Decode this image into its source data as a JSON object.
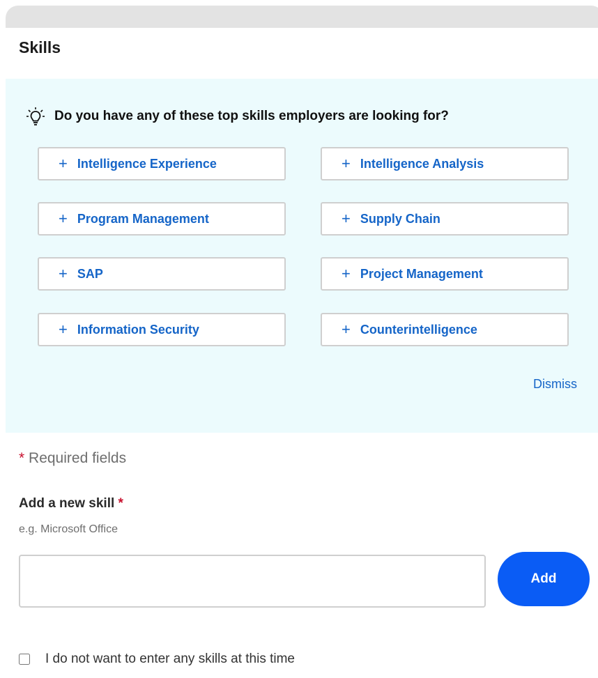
{
  "section": {
    "title": "Skills"
  },
  "suggestions": {
    "heading": "Do you have any of these top skills employers are looking for?",
    "plus_symbol": "+",
    "skills": [
      "Intelligence Experience",
      "Intelligence Analysis",
      "Program Management",
      "Supply Chain",
      "SAP",
      "Project Management",
      "Information Security",
      "Counterintelligence"
    ],
    "dismiss_label": "Dismiss",
    "panel_color": "#ecfbfd",
    "link_color": "#1565c8"
  },
  "form": {
    "required_star": "*",
    "required_text": "Required fields",
    "skill_label": "Add a new skill",
    "skill_hint": "e.g. Microsoft Office",
    "skill_value": "",
    "add_label": "Add",
    "add_button_color": "#0a5cf5",
    "opt_out_label": "I do not want to enter any skills at this time",
    "opt_out_checked": false
  }
}
